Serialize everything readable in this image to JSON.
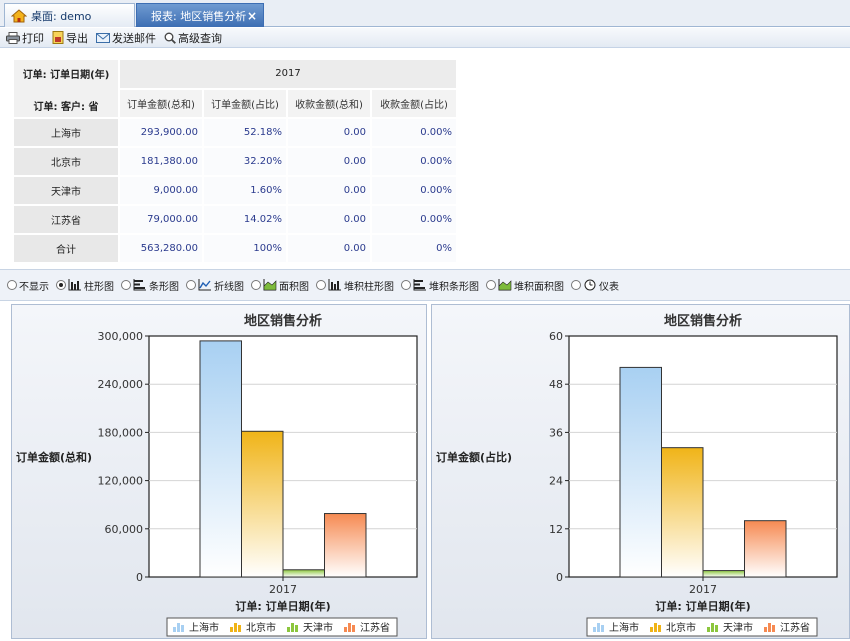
{
  "tabs": [
    {
      "label": "桌面: demo"
    },
    {
      "label": "报表: 地区销售分析",
      "close": "×"
    }
  ],
  "toolbar": {
    "print": "打印",
    "export": "导出",
    "send_mail": "发送邮件",
    "advanced_query": "高级查询"
  },
  "table": {
    "corner_top": "订单: 订单日期(年)",
    "corner_bottom": "订单: 客户: 省",
    "year": "2017",
    "columns": [
      "订单金额(总和)",
      "订单金额(占比)",
      "收款金额(总和)",
      "收款金额(占比)"
    ],
    "rows": [
      {
        "label": "上海市",
        "cells": [
          "293,900.00",
          "52.18%",
          "0.00",
          "0.00%"
        ]
      },
      {
        "label": "北京市",
        "cells": [
          "181,380.00",
          "32.20%",
          "0.00",
          "0.00%"
        ]
      },
      {
        "label": "天津市",
        "cells": [
          "9,000.00",
          "1.60%",
          "0.00",
          "0.00%"
        ]
      },
      {
        "label": "江苏省",
        "cells": [
          "79,000.00",
          "14.02%",
          "0.00",
          "0.00%"
        ]
      },
      {
        "label": "合计",
        "cells": [
          "563,280.00",
          "100%",
          "0.00",
          "0%"
        ]
      }
    ]
  },
  "chart_types": {
    "selected": 1,
    "options": [
      "不显示",
      "柱形图",
      "条形图",
      "折线图",
      "面积图",
      "堆积柱形图",
      "堆积条形图",
      "堆积面积图",
      "仪表"
    ]
  },
  "colors": {
    "上海市": "#a8d0f2",
    "北京市": "#f0b418",
    "天津市": "#8cc63e",
    "江苏省": "#f68a52"
  },
  "chart_data": [
    {
      "type": "bar",
      "title": "地区销售分析",
      "xlabel": "订单: 订单日期(年)",
      "ylabel": "订单金额(总和)",
      "categories": [
        "2017"
      ],
      "ylim": [
        0,
        300000
      ],
      "yticks": [
        "0",
        "60,000",
        "120,000",
        "180,000",
        "240,000",
        "300,000"
      ],
      "grid": true,
      "legend": "bottom",
      "series": [
        {
          "name": "上海市",
          "values": [
            293900
          ]
        },
        {
          "name": "北京市",
          "values": [
            181380
          ]
        },
        {
          "name": "天津市",
          "values": [
            9000
          ]
        },
        {
          "name": "江苏省",
          "values": [
            79000
          ]
        }
      ]
    },
    {
      "type": "bar",
      "title": "地区销售分析",
      "xlabel": "订单: 订单日期(年)",
      "ylabel": "订单金额(占比)",
      "categories": [
        "2017"
      ],
      "ylim": [
        0,
        60
      ],
      "yticks": [
        "0",
        "12",
        "24",
        "36",
        "48",
        "60"
      ],
      "grid": true,
      "legend": "bottom",
      "series": [
        {
          "name": "上海市",
          "values": [
            52.18
          ]
        },
        {
          "name": "北京市",
          "values": [
            32.2
          ]
        },
        {
          "name": "天津市",
          "values": [
            1.6
          ]
        },
        {
          "name": "江苏省",
          "values": [
            14.02
          ]
        }
      ]
    }
  ]
}
